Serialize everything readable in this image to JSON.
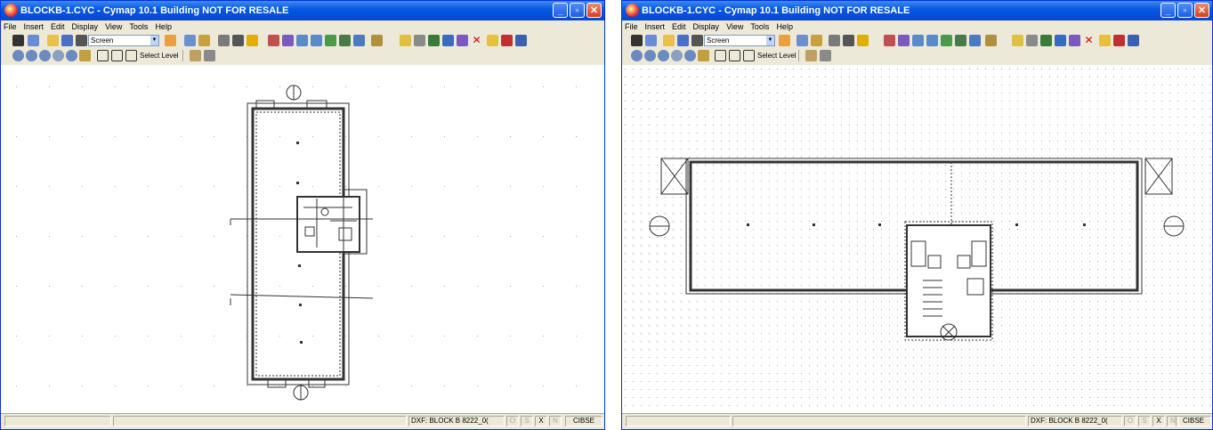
{
  "windows": [
    {
      "title": "BLOCKB-1.CYC - Cymap 10.1 Building NOT FOR RESALE",
      "menu": [
        "File",
        "Insert",
        "Edit",
        "Display",
        "View",
        "Tools",
        "Help"
      ],
      "combo_value": "Screen",
      "select_level_label": "Select Level",
      "status": {
        "dxf": "DXF: BLOCK B 8222_0(",
        "o": "O",
        "s": "S",
        "x": "X",
        "n": "N",
        "standard": "CIBSE"
      }
    },
    {
      "title": "BLOCKB-1.CYC - Cymap 10.1 Building NOT FOR RESALE",
      "menu": [
        "File",
        "Insert",
        "Edit",
        "Display",
        "View",
        "Tools",
        "Help"
      ],
      "combo_value": "Screen",
      "select_level_label": "Select Level",
      "status": {
        "dxf": "DXF: BLOCK B 8222_0(",
        "o": "O",
        "s": "S",
        "x": "X",
        "n": "N",
        "standard": "CIBSE"
      }
    }
  ],
  "colors": {
    "titlebar": "#0a5ae0",
    "toolbar_bg": "#ece9d8",
    "canvas_bg": "#ffffff",
    "wall": "#333333"
  }
}
